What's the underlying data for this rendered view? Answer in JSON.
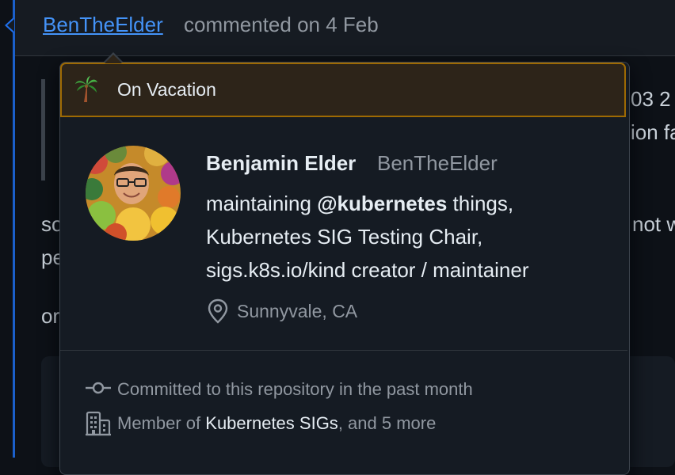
{
  "comment": {
    "author": "BenTheElder",
    "meta": "commented on 4 Feb"
  },
  "background_text": {
    "right_top_1": "03 2",
    "right_top_2": "ion fa",
    "left_para_1": "so",
    "left_para_2": "pe",
    "left_para_3": "or",
    "right_para": "not w"
  },
  "hovercard": {
    "status": {
      "emoji": "palm-tree",
      "text": "On Vacation"
    },
    "name": "Benjamin Elder",
    "login": "BenTheElder",
    "bio": {
      "line1_prefix": "maintaining ",
      "line1_mention": "@kubernetes",
      "line1_suffix": " things,",
      "line2": "Kubernetes SIG Testing Chair,",
      "line3": "sigs.k8s.io/kind creator / maintainer"
    },
    "location": "Sunnyvale, CA",
    "activity": "Committed to this repository in the past month",
    "membership": {
      "prefix": "Member of ",
      "org": "Kubernetes SIGs",
      "suffix": ", and 5 more"
    }
  },
  "colors": {
    "background": "#0d1117",
    "link": "#4493f8",
    "vacation_border": "#9e6a03",
    "vacation_bg": "#2d2419",
    "muted": "#9198a1"
  }
}
